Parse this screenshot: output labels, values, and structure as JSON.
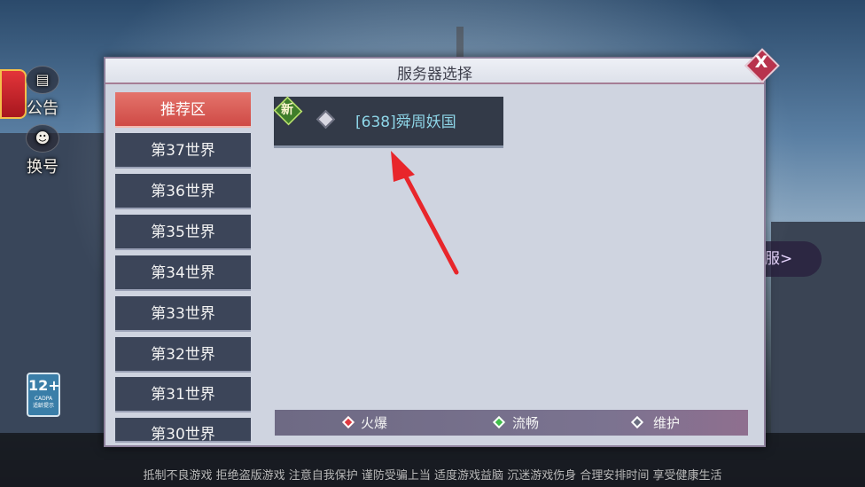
{
  "app": {
    "dialog_title": "服务器选择",
    "close_label": "X"
  },
  "side": {
    "notice_label": "公告",
    "switch_label": "换号",
    "age_badge": "12+",
    "age_badge_sub": "CADPA",
    "age_badge_note": "适龄提示",
    "right_peek": "服>"
  },
  "tabs": [
    {
      "label": "推荐区",
      "active": true
    },
    {
      "label": "第37世界"
    },
    {
      "label": "第36世界"
    },
    {
      "label": "第35世界"
    },
    {
      "label": "第34世界"
    },
    {
      "label": "第33世界"
    },
    {
      "label": "第32世界"
    },
    {
      "label": "第31世界"
    },
    {
      "label": "第30世界"
    }
  ],
  "servers": [
    {
      "badge": "新",
      "name": "[638]舜周妖国",
      "status": "maintenance"
    }
  ],
  "legend": {
    "hot": "火爆",
    "smooth": "流畅",
    "maintenance": "维护"
  },
  "colors": {
    "hot": "#e0383f",
    "smooth": "#3fbf4a",
    "maintenance": "#6a6e80",
    "active_tab": "#cf4a45",
    "server_name": "#8ed6e8"
  },
  "footer": {
    "notice": "抵制不良游戏 拒绝盗版游戏 注意自我保护 谨防受骗上当 适度游戏益脑 沉迷游戏伤身 合理安排时间 享受健康生活"
  }
}
